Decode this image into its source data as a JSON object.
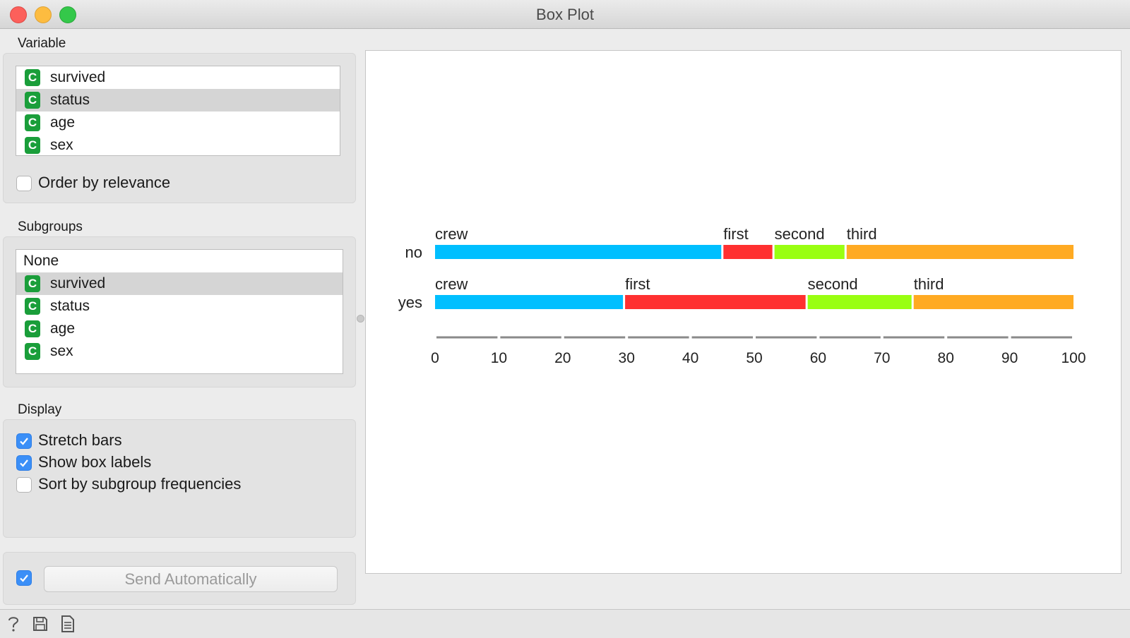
{
  "window": {
    "title": "Box Plot"
  },
  "variable": {
    "label": "Variable",
    "items": [
      {
        "name": "survived",
        "icon": "C",
        "selected": false
      },
      {
        "name": "status",
        "icon": "C",
        "selected": true
      },
      {
        "name": "age",
        "icon": "C",
        "selected": false
      },
      {
        "name": "sex",
        "icon": "C",
        "selected": false
      }
    ],
    "order_by_relevance": {
      "label": "Order by relevance",
      "checked": false
    }
  },
  "subgroups": {
    "label": "Subgroups",
    "none_label": "None",
    "items": [
      {
        "name": "survived",
        "icon": "C",
        "selected": true
      },
      {
        "name": "status",
        "icon": "C",
        "selected": false
      },
      {
        "name": "age",
        "icon": "C",
        "selected": false
      },
      {
        "name": "sex",
        "icon": "C",
        "selected": false
      }
    ]
  },
  "display": {
    "label": "Display",
    "options": [
      {
        "label": "Stretch bars",
        "checked": true
      },
      {
        "label": "Show box labels",
        "checked": true
      },
      {
        "label": "Sort by subgroup frequencies",
        "checked": false
      }
    ]
  },
  "send": {
    "label": "Send Automatically",
    "checked": true
  },
  "chart_data": {
    "type": "bar",
    "stacked": true,
    "orientation": "horizontal",
    "x_range": [
      0,
      100
    ],
    "x_ticks": [
      0,
      10,
      20,
      30,
      40,
      50,
      60,
      70,
      80,
      90,
      100
    ],
    "rows": [
      {
        "label": "no",
        "segments": [
          {
            "label": "crew",
            "value": 45,
            "color": "#00bfff"
          },
          {
            "label": "first",
            "value": 8,
            "color": "#ff3030"
          },
          {
            "label": "second",
            "value": 11.3,
            "color": "#99ff11"
          },
          {
            "label": "third",
            "value": 35.7,
            "color": "#ffaa22"
          }
        ]
      },
      {
        "label": "yes",
        "segments": [
          {
            "label": "crew",
            "value": 29.6,
            "color": "#00bfff"
          },
          {
            "label": "first",
            "value": 28.6,
            "color": "#ff3030"
          },
          {
            "label": "second",
            "value": 16.6,
            "color": "#99ff11"
          },
          {
            "label": "third",
            "value": 25.2,
            "color": "#ffaa22"
          }
        ]
      }
    ]
  }
}
